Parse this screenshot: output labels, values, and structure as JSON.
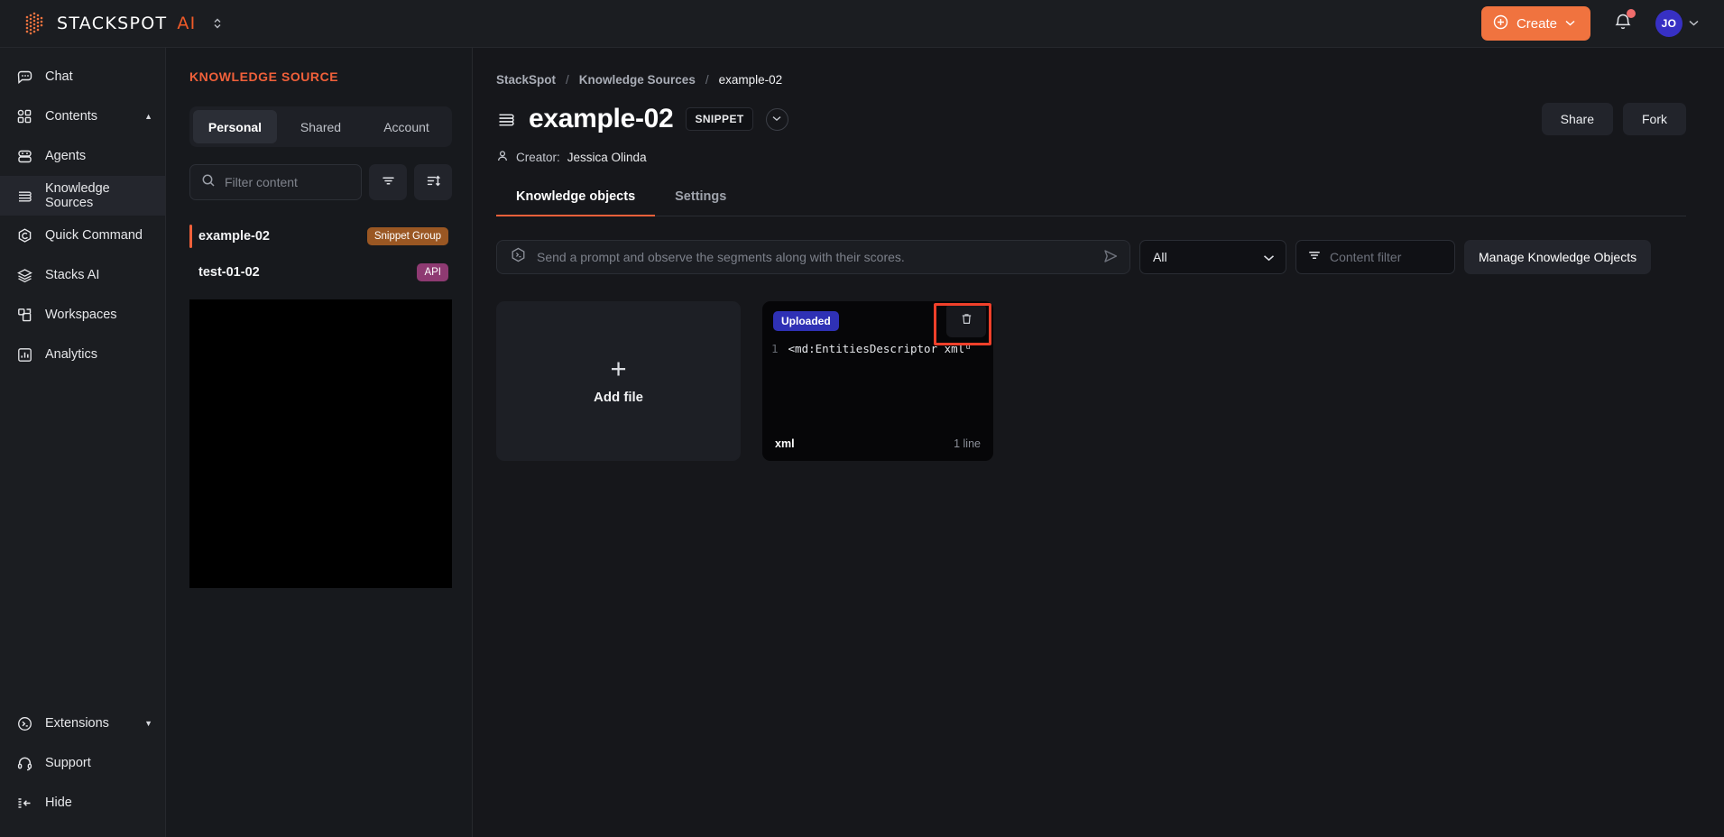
{
  "topbar": {
    "brand_word": "STACKSPOT",
    "brand_ai": "AI",
    "brand_switch_icon": "chevron-up-down-icon",
    "create_label": "Create",
    "create_icon": "plus-circle-icon",
    "create_caret": "⌄",
    "create_color": "#f0733f",
    "bell_icon": "bell-icon",
    "notification_dot_color": "#f06c6c",
    "avatar_initials": "JO",
    "avatar_color": "#3730c4",
    "avatar_caret": "⌄"
  },
  "sidebar": {
    "items": [
      {
        "label": "Chat",
        "icon": "chat-bubble-icon",
        "active": false,
        "caret": ""
      },
      {
        "label": "Contents",
        "icon": "grid-squares-icon",
        "active": false,
        "caret": "▲"
      },
      {
        "label": "Agents",
        "icon": "robot-icon",
        "active": false,
        "caret": ""
      },
      {
        "label": "Knowledge Sources",
        "icon": "knowledge-source-icon",
        "active": true,
        "caret": ""
      },
      {
        "label": "Quick Command",
        "icon": "quick-command-icon",
        "active": false,
        "caret": ""
      },
      {
        "label": "Stacks AI",
        "icon": "layers-icon",
        "active": false,
        "caret": ""
      },
      {
        "label": "Workspaces",
        "icon": "workspaces-icon",
        "active": false,
        "caret": ""
      },
      {
        "label": "Analytics",
        "icon": "bar-chart-icon",
        "active": false,
        "caret": ""
      }
    ],
    "bottom_items": [
      {
        "label": "Extensions",
        "icon": "terminal-circle-icon",
        "caret": "▼"
      },
      {
        "label": "Support",
        "icon": "headset-icon",
        "caret": ""
      },
      {
        "label": "Hide",
        "icon": "collapse-left-icon",
        "caret": ""
      }
    ]
  },
  "ks_panel": {
    "title": "KNOWLEDGE SOURCE",
    "title_color": "#f0603a",
    "tabs": [
      {
        "label": "Personal",
        "active": true
      },
      {
        "label": "Shared",
        "active": false
      },
      {
        "label": "Account",
        "active": false
      }
    ],
    "search": {
      "placeholder": "Filter content",
      "value": "",
      "icon": "search-icon"
    },
    "filter_button_icon": "filter-icon",
    "sort_button_icon": "sort-icon",
    "list": [
      {
        "name": "example-02",
        "badge": "Snippet Group",
        "badge_color": "#9a5723",
        "selected": true
      },
      {
        "name": "test-01-02",
        "badge": "API",
        "badge_color": "#8e3a72",
        "selected": false
      }
    ]
  },
  "main": {
    "breadcrumb": [
      {
        "label": "StackSpot",
        "current": false
      },
      {
        "label": "Knowledge Sources",
        "current": false
      },
      {
        "label": "example-02",
        "current": true
      }
    ],
    "breadcrumb_separator": "/",
    "title": "example-02",
    "title_icon": "knowledge-source-icon",
    "type_badge": "SNIPPET",
    "title_dropdown_icon": "chevron-down-icon",
    "actions": [
      {
        "label": "Share"
      },
      {
        "label": "Fork"
      }
    ],
    "creator_label": "Creator:",
    "creator_name": "Jessica Olinda",
    "creator_icon": "user-icon",
    "tabs": [
      {
        "label": "Knowledge objects",
        "active": true
      },
      {
        "label": "Settings",
        "active": false
      }
    ],
    "toolbar": {
      "prompt_placeholder": "Send a prompt and observe the segments along with their scores.",
      "prompt_value": "",
      "prompt_icon": "terminal-hex-icon",
      "send_icon": "send-icon",
      "select_value": "All",
      "select_icon": "chevron-down-icon",
      "content_filter_placeholder": "Content filter",
      "content_filter_value": "",
      "content_filter_icon": "filter-icon",
      "manage_label": "Manage Knowledge Objects"
    },
    "add_card": {
      "label": "Add file",
      "icon": "plus-icon"
    },
    "snippet_card": {
      "status_badge": "Uploaded",
      "status_color": "#2f31b5",
      "delete_icon": "trash-icon",
      "line_number": "1",
      "code_text": "<md:EntitiesDescriptor xmlᵘ",
      "language": "xml",
      "line_count": "1 line",
      "highlight_color": "#f0402a"
    }
  }
}
